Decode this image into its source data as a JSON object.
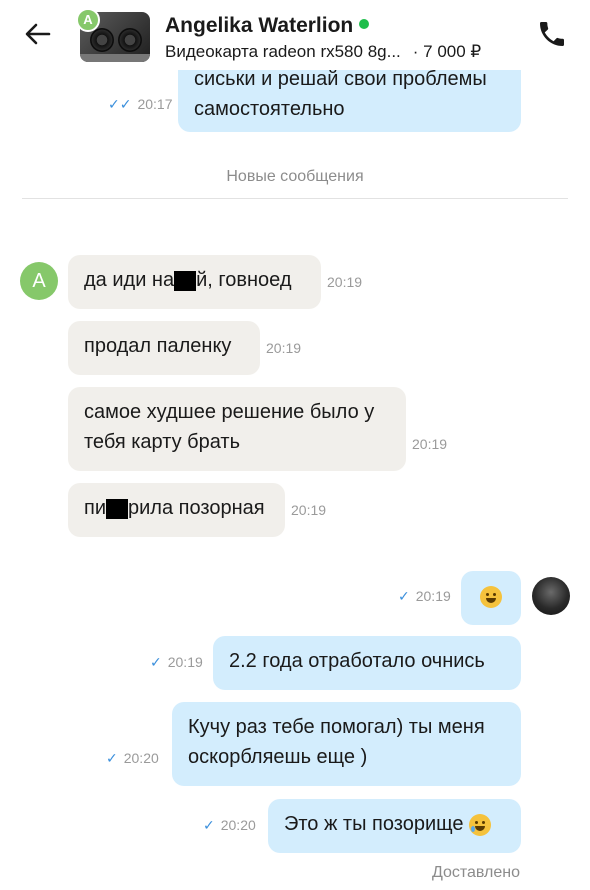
{
  "header": {
    "name": "Angelika Waterlion",
    "item_title": "Видеокарта radeon rx580 8g...",
    "price": "· 7 000 ₽",
    "avatar_letter": "A"
  },
  "chat": {
    "divider": "Новые сообщения",
    "incoming_avatar_letter": "A",
    "messages": [
      {
        "dir": "out",
        "line1": "сиськи и решай свои проблемы",
        "line2": "самостоятельно",
        "time": "20:17",
        "read": true
      },
      {
        "dir": "in",
        "text_before": "да иди на",
        "text_after": "й, говноед",
        "redacted": true,
        "time": "20:19"
      },
      {
        "dir": "in",
        "text": "продал паленку",
        "time": "20:19"
      },
      {
        "dir": "in",
        "line1": "самое худшее решение было у",
        "line2": "тебя карту брать",
        "time": "20:19"
      },
      {
        "dir": "in",
        "text_before": "пи",
        "text_after": "рила позорная",
        "redacted": true,
        "time": "20:19"
      },
      {
        "dir": "out",
        "emoji": "grinning-face",
        "time": "20:19",
        "read": false
      },
      {
        "dir": "out",
        "text": "2.2 года отработало очнись",
        "time": "20:19",
        "read": false
      },
      {
        "dir": "out",
        "line1": "Кучу раз тебе помогал) ты меня",
        "line2": "оскорбляешь еще )",
        "time": "20:20",
        "read": false
      },
      {
        "dir": "out",
        "text": "Это ж ты позорище",
        "emoji": "crying-smile-face",
        "time": "20:20",
        "read": false
      }
    ],
    "status": "Доставлено"
  },
  "colors": {
    "outgoing_bubble": "#d3edfd",
    "incoming_bubble": "#f1efeb",
    "online": "#1fbe4b",
    "check": "#3a8fdc",
    "avatar_green": "#86c86a"
  }
}
